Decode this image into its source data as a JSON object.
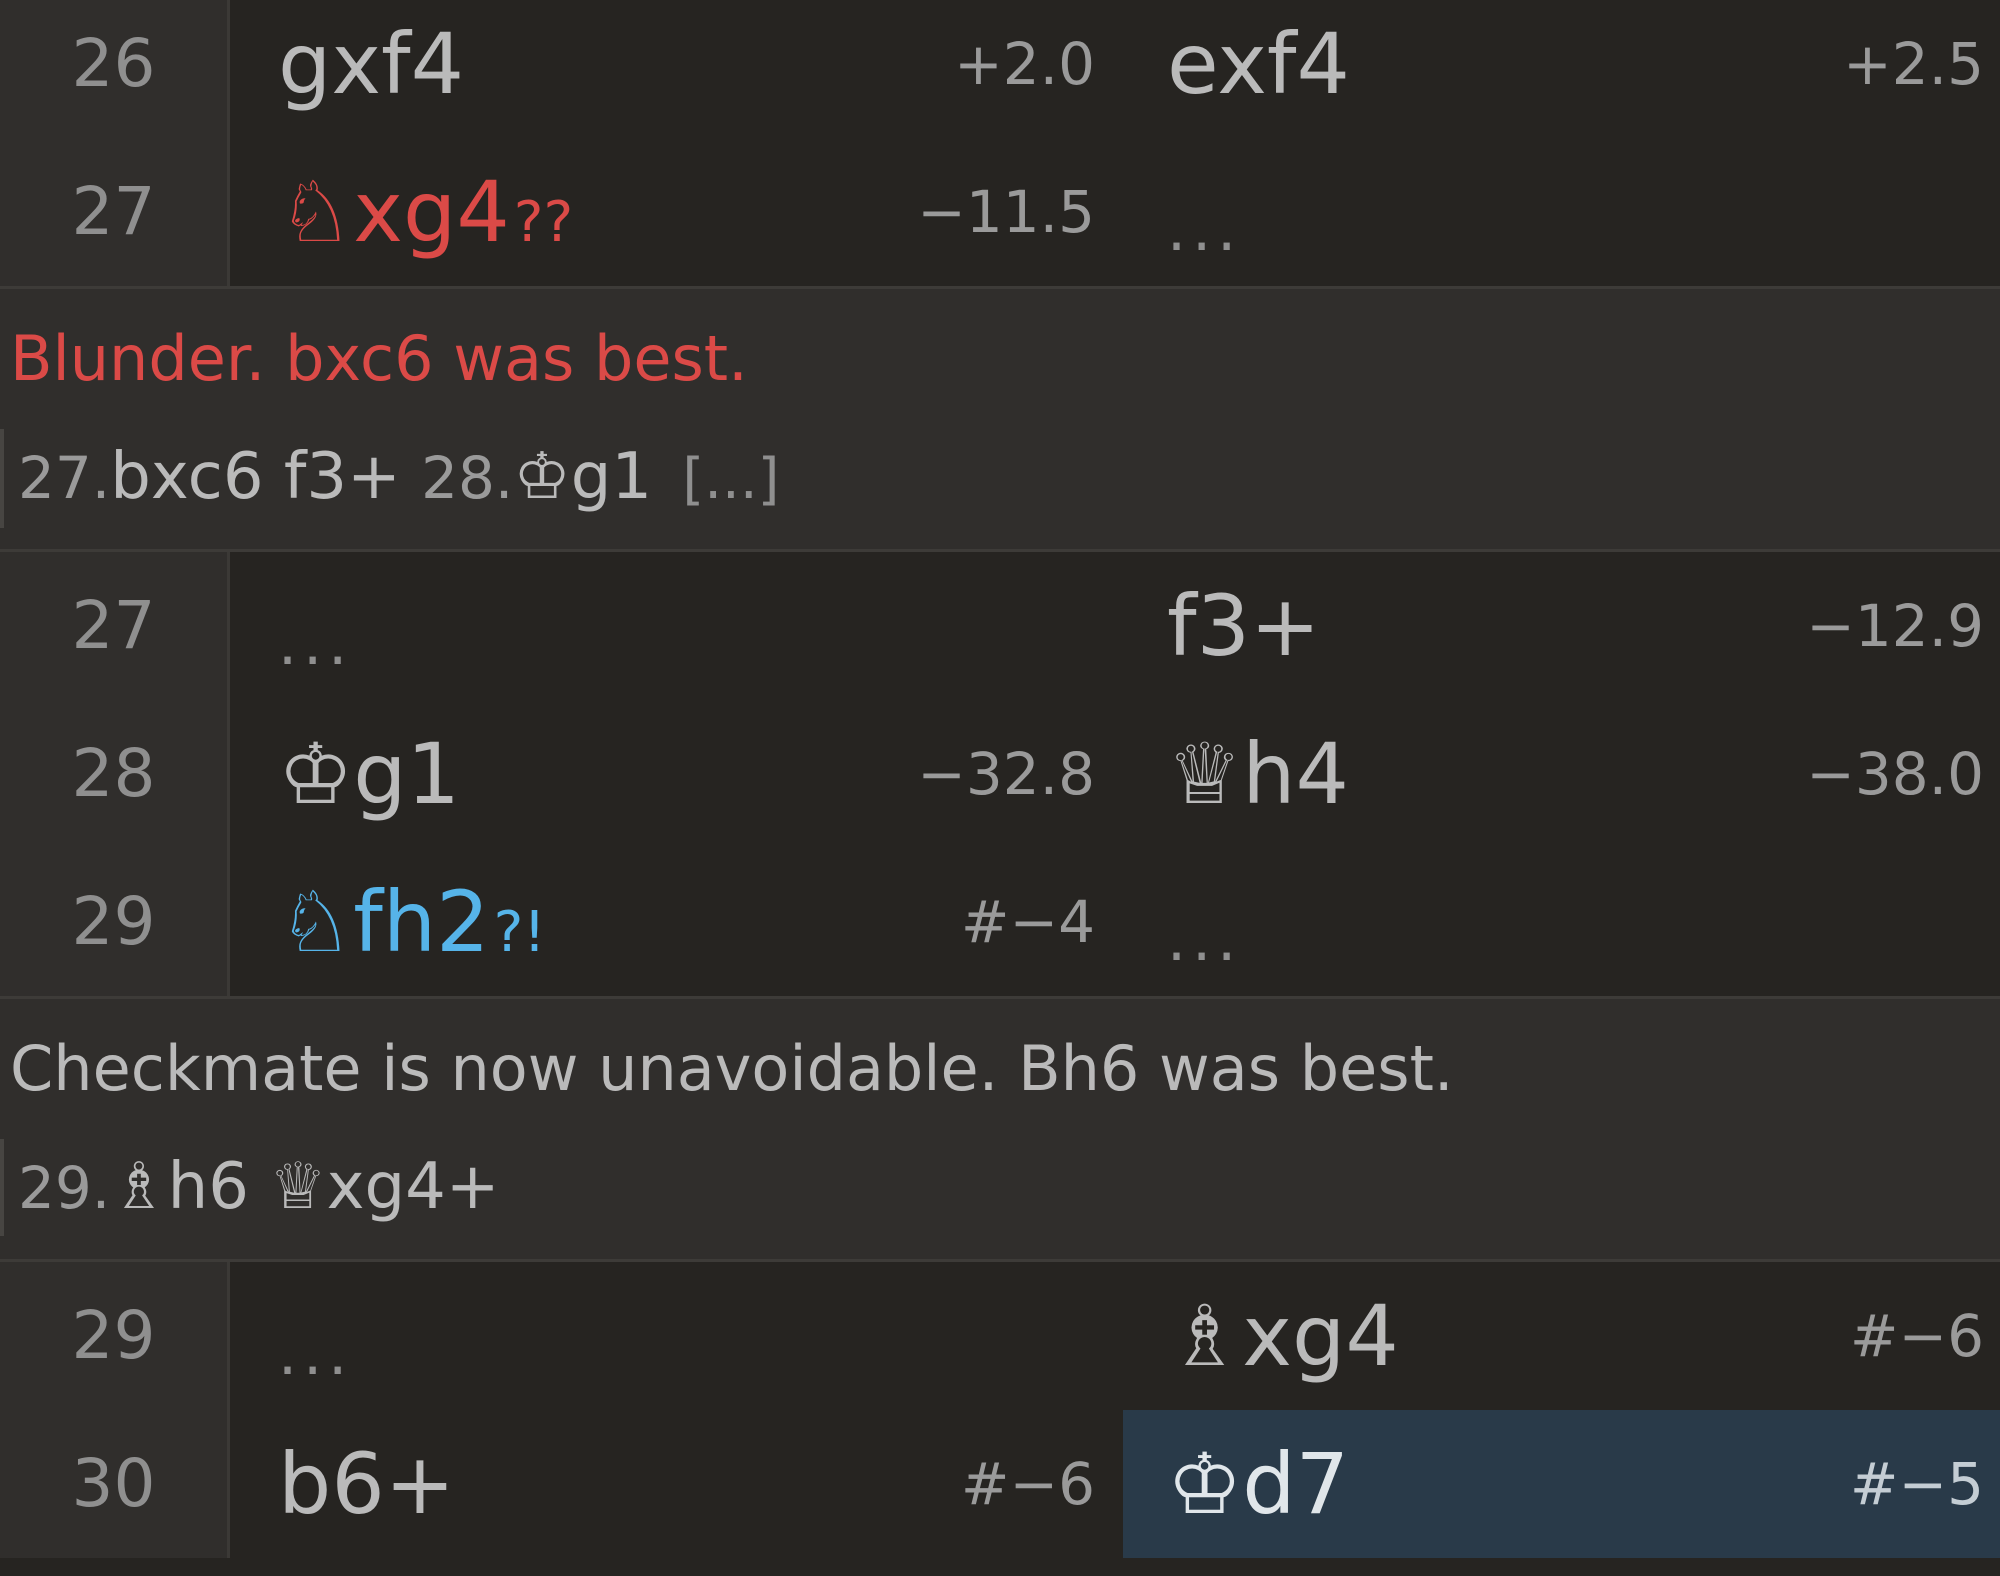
{
  "moves": [
    {
      "block": 1,
      "rows": [
        {
          "num": "26",
          "white": {
            "san": "gxf4",
            "nag": "",
            "eval": "+2.0"
          },
          "black": {
            "san": "exf4",
            "nag": "",
            "eval": "+2.5"
          }
        },
        {
          "num": "27",
          "white": {
            "san": "♘xg4",
            "nag": "??",
            "eval": "−11.5",
            "class": "blunder"
          },
          "black": {
            "ellipsis": "..."
          }
        }
      ]
    }
  ],
  "interrupt_1": {
    "comment": "Blunder. bxc6 was best.",
    "variation": {
      "n1": "27.",
      "m1": "bxc6",
      "m2": "f3+",
      "n2": "28.",
      "m3": "♔g1",
      "more": "[...]"
    }
  },
  "block_2": {
    "row_a": {
      "num": "27",
      "white_ellipsis": "...",
      "black_san": "f3+",
      "black_eval": "−12.9"
    },
    "row_b": {
      "num": "28",
      "white_san": "♔g1",
      "white_eval": "−32.8",
      "black_san": "♕h4",
      "black_eval": "−38.0"
    },
    "row_c": {
      "num": "29",
      "white_san": "♘fh2",
      "white_nag": "?!",
      "white_eval": "#−4",
      "black_ellipsis": "..."
    }
  },
  "interrupt_2": {
    "comment": "Checkmate is now unavoidable. Bh6 was best.",
    "variation": {
      "n1": "29.",
      "m1": "♗h6",
      "m2": "♕xg4+"
    }
  },
  "block_3": {
    "row_a": {
      "num": "29",
      "white_ellipsis": "...",
      "black_san": "♗xg4",
      "black_eval": "#−6"
    },
    "row_b": {
      "num": "30",
      "white_san": "b6+",
      "white_eval": "#−6",
      "black_san": "♔d7",
      "black_eval": "#−5"
    }
  },
  "colors": {
    "background": "#262421",
    "index_background": "#302e2c",
    "blunder": "#db4a47",
    "inaccuracy": "#56b4e9",
    "active_move_background": "#293a49"
  }
}
